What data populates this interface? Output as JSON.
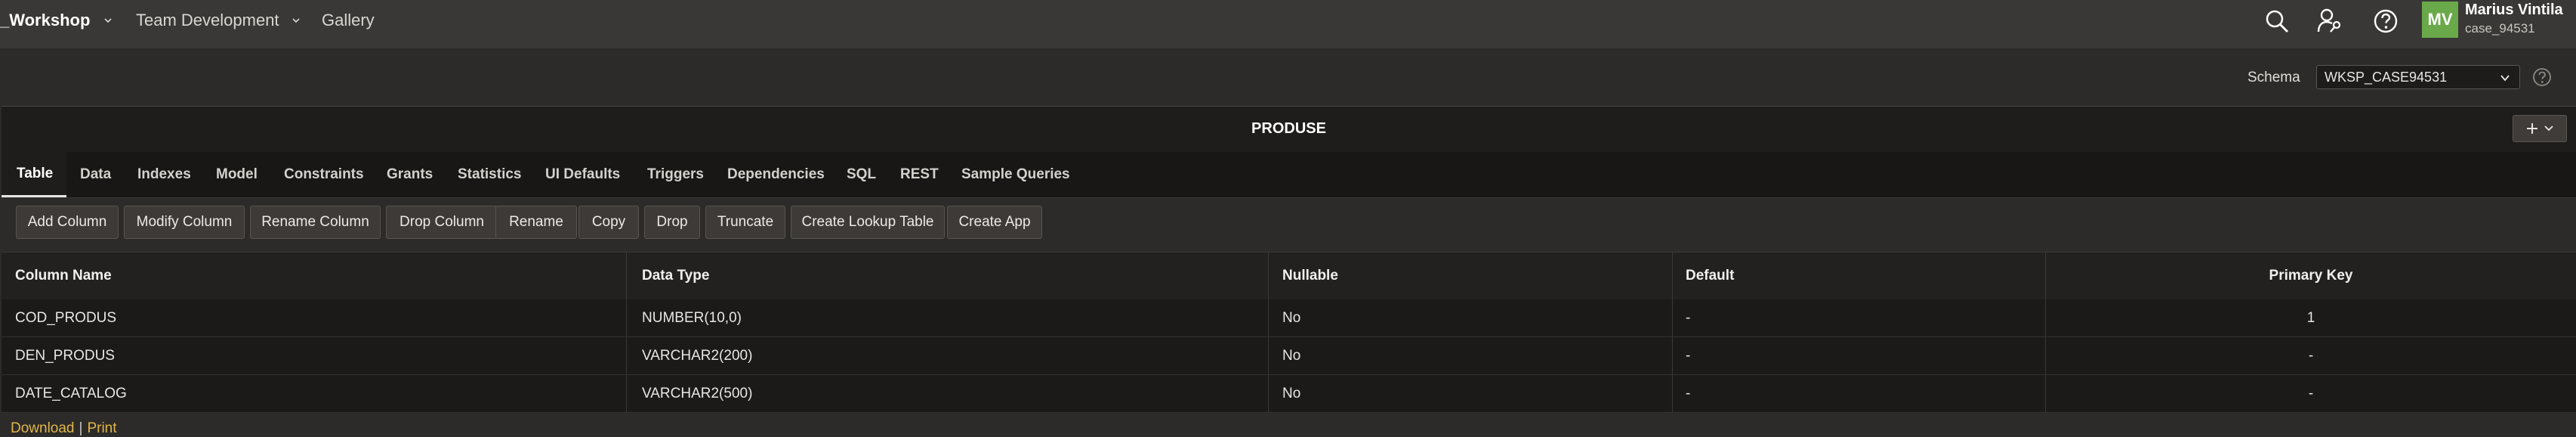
{
  "topnav": {
    "brand": "_Workshop",
    "items": [
      "Team Development",
      "Gallery"
    ]
  },
  "user": {
    "initials": "MV",
    "name": "Marius Vintila",
    "workspace": "case_94531"
  },
  "schema": {
    "label": "Schema",
    "value": "WKSP_CASE94531"
  },
  "panel": {
    "title": "PRODUSE"
  },
  "tabs": [
    "Table",
    "Data",
    "Indexes",
    "Model",
    "Constraints",
    "Grants",
    "Statistics",
    "UI Defaults",
    "Triggers",
    "Dependencies",
    "SQL",
    "REST",
    "Sample Queries"
  ],
  "toolbar": [
    "Add Column",
    "Modify Column",
    "Rename Column",
    "Drop Column",
    "Rename",
    "Copy",
    "Drop",
    "Truncate",
    "Create Lookup Table",
    "Create App"
  ],
  "columns": {
    "headers": [
      "Column Name",
      "Data Type",
      "Nullable",
      "Default",
      "Primary Key"
    ],
    "rows": [
      [
        "COD_PRODUS",
        "NUMBER(10,0)",
        "No",
        "-",
        "1"
      ],
      [
        "DEN_PRODUS",
        "VARCHAR2(200)",
        "No",
        "-",
        "-"
      ],
      [
        "DATE_CATALOG",
        "VARCHAR2(500)",
        "No",
        "-",
        "-"
      ]
    ]
  },
  "footer": {
    "download": "Download",
    "separator": "|",
    "print": "Print"
  },
  "colors": {
    "topbar": "#3a3836",
    "avatar": "#6aa94a",
    "link": "#e0b64b"
  },
  "icons": [
    "chevron-down-icon",
    "search-icon",
    "user-key-icon",
    "help-icon",
    "plus-icon"
  ]
}
